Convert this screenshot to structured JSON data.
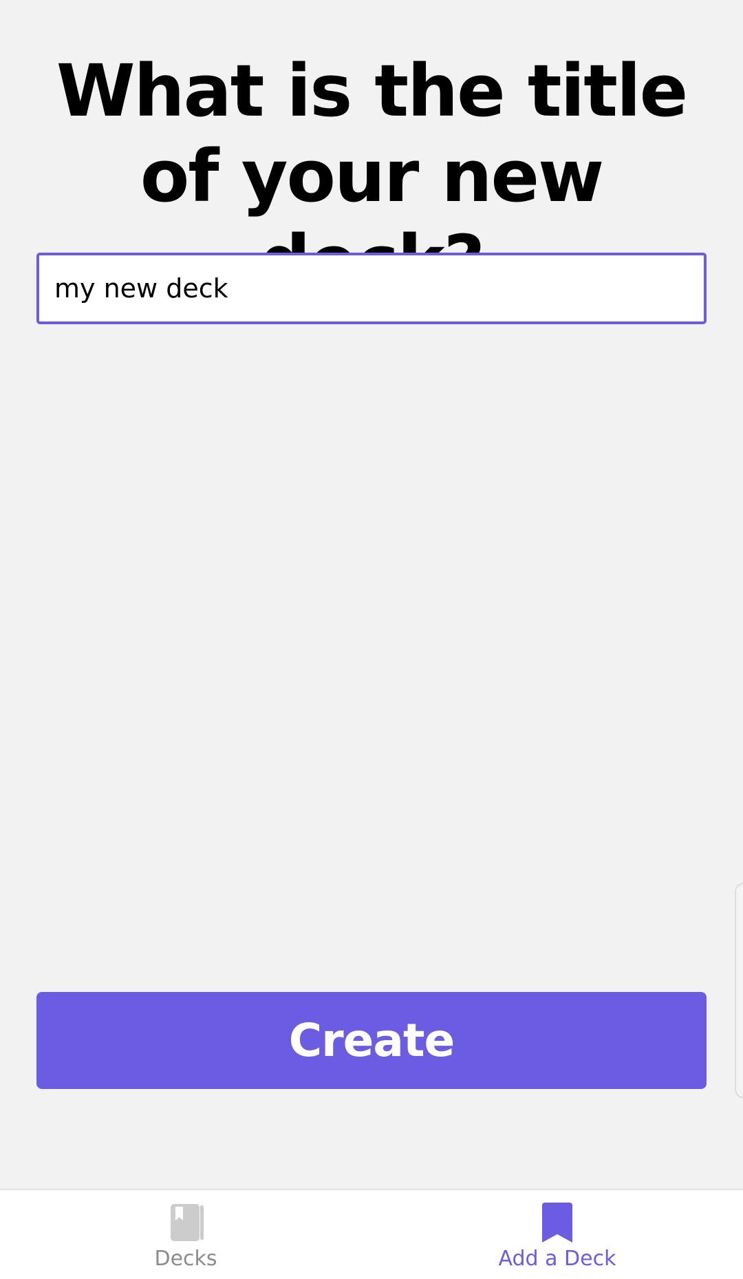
{
  "heading": {
    "text": "What is the title of your new deck?"
  },
  "title_field": {
    "value": "my new deck"
  },
  "create_button": {
    "label": "Create"
  },
  "tab_bar": {
    "tabs": [
      {
        "label": "Decks",
        "icon": "book-icon",
        "active": false
      },
      {
        "label": "Add a Deck",
        "icon": "bookmark-icon",
        "active": true
      }
    ]
  },
  "colors": {
    "accent": "#6c5ce1",
    "background": "#f2f2f2",
    "inactive_tab": "#8c8c8c",
    "inactive_icon": "#cccccc"
  }
}
